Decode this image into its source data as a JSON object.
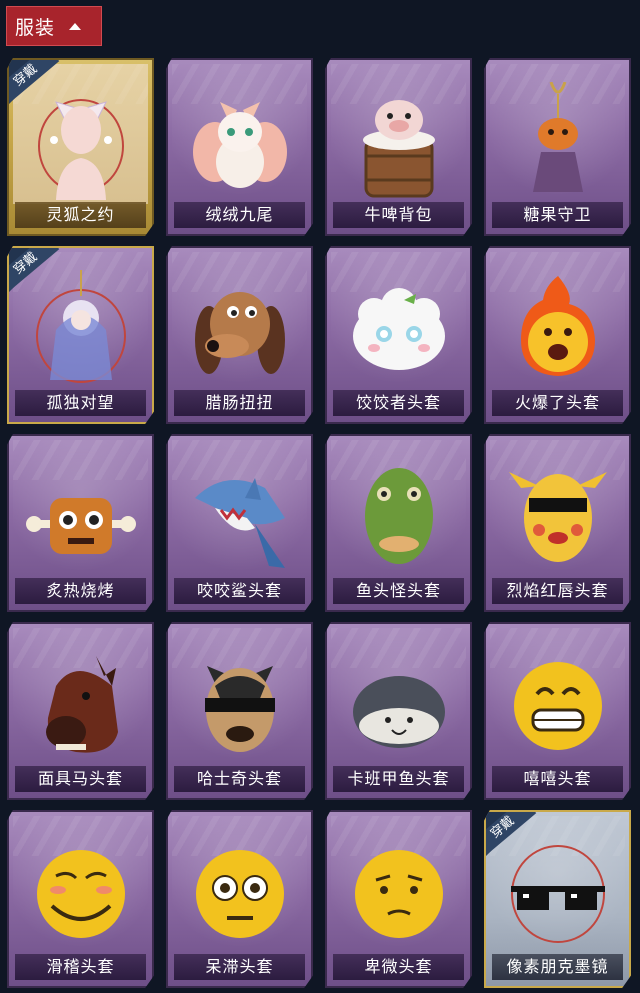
{
  "header": {
    "title": "服装"
  },
  "worn_label": "穿戴",
  "items": [
    {
      "name": "灵狐之约",
      "worn": true,
      "frame": "gold",
      "icon": "fox-outfit-icon"
    },
    {
      "name": "绒绒九尾",
      "worn": false,
      "frame": "purple",
      "icon": "nine-tail-fox-icon"
    },
    {
      "name": "牛啤背包",
      "worn": false,
      "frame": "purple",
      "icon": "cow-barrel-backpack-icon"
    },
    {
      "name": "糖果守卫",
      "worn": false,
      "frame": "purple",
      "icon": "pumpkin-charm-icon"
    },
    {
      "name": "孤独对望",
      "worn": true,
      "frame": "purple",
      "icon": "doll-charm-icon"
    },
    {
      "name": "腊肠扭扭",
      "worn": false,
      "frame": "purple",
      "icon": "dachshund-head-icon"
    },
    {
      "name": "饺饺者头套",
      "worn": false,
      "frame": "purple",
      "icon": "dumpling-head-icon"
    },
    {
      "name": "火爆了头套",
      "worn": false,
      "frame": "purple",
      "icon": "fire-head-icon"
    },
    {
      "name": "炙热烧烤",
      "worn": false,
      "frame": "purple",
      "icon": "bbq-meat-icon"
    },
    {
      "name": "咬咬鲨头套",
      "worn": false,
      "frame": "purple",
      "icon": "shark-head-icon"
    },
    {
      "name": "鱼头怪头套",
      "worn": false,
      "frame": "purple",
      "icon": "fish-head-icon"
    },
    {
      "name": "烈焰红唇头套",
      "worn": false,
      "frame": "purple",
      "icon": "yellow-mask-icon"
    },
    {
      "name": "面具马头套",
      "worn": false,
      "frame": "purple",
      "icon": "horse-head-icon"
    },
    {
      "name": "哈士奇头套",
      "worn": false,
      "frame": "purple",
      "icon": "husky-head-icon"
    },
    {
      "name": "卡班甲鱼头套",
      "worn": false,
      "frame": "purple",
      "icon": "fish-blob-head-icon"
    },
    {
      "name": "嘻嘻头套",
      "worn": false,
      "frame": "purple",
      "icon": "grin-emoji-icon"
    },
    {
      "name": "滑稽头套",
      "worn": false,
      "frame": "purple",
      "icon": "funny-emoji-icon"
    },
    {
      "name": "呆滞头套",
      "worn": false,
      "frame": "purple",
      "icon": "stare-emoji-icon"
    },
    {
      "name": "卑微头套",
      "worn": false,
      "frame": "purple",
      "icon": "humble-emoji-icon"
    },
    {
      "name": "像素朋克墨镜",
      "worn": true,
      "frame": "blue",
      "icon": "pixel-sunglasses-icon"
    }
  ],
  "colors": {
    "background": "#0f1624",
    "tab": "#a8242c",
    "card_purple": "#8b6aa3",
    "card_gold": "#c9a94a",
    "worn_badge": "#2f4565"
  }
}
